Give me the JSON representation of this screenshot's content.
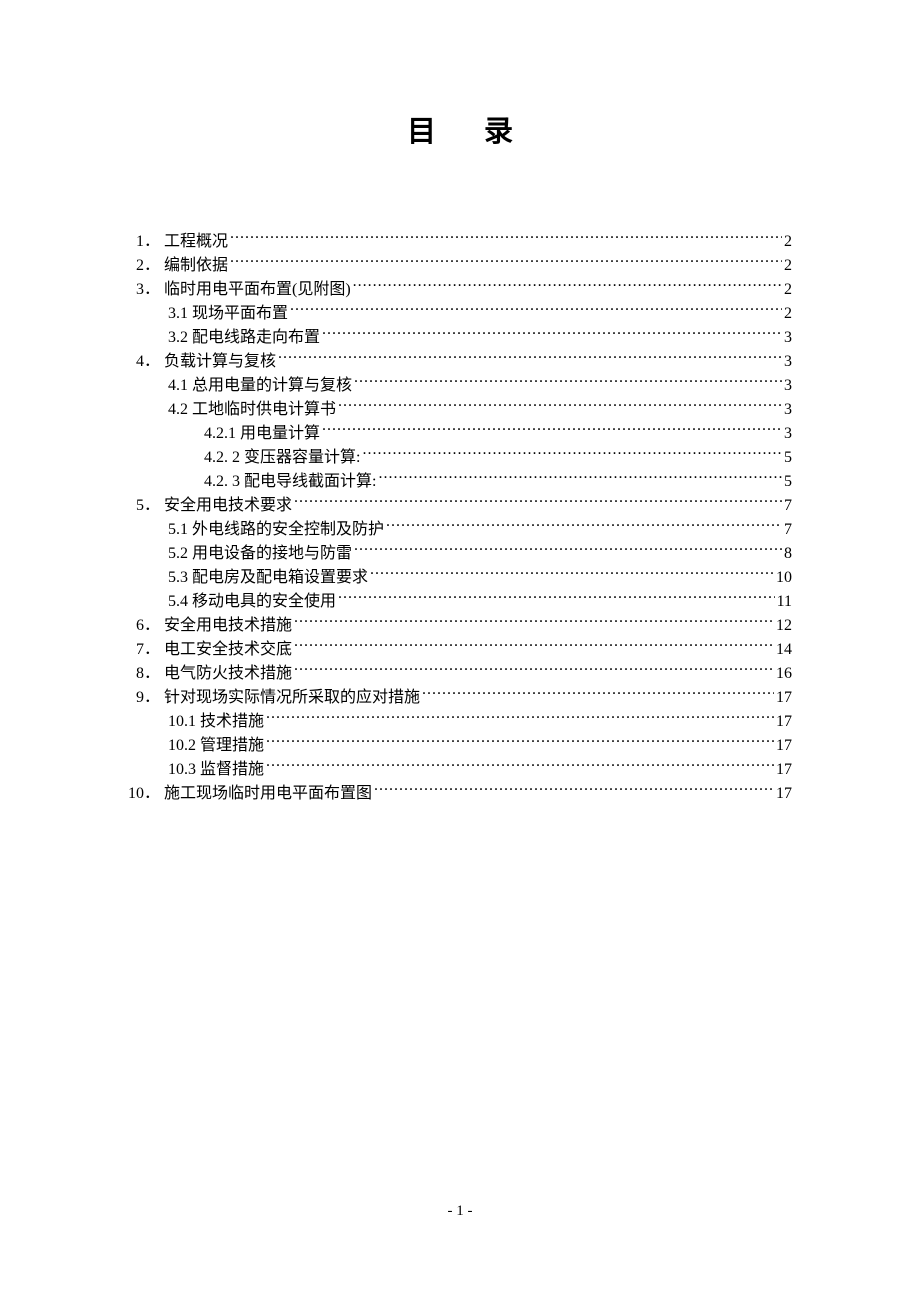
{
  "title": "目录",
  "toc": [
    {
      "level": 0,
      "num": "1．",
      "text": "工程概况",
      "page": "2"
    },
    {
      "level": 0,
      "num": "2．",
      "text": "编制依据",
      "page": "2"
    },
    {
      "level": 0,
      "num": "3．",
      "text": "临时用电平面布置(见附图)",
      "page": "2"
    },
    {
      "level": 1,
      "num": "",
      "text": "3.1  现场平面布置",
      "page": "2"
    },
    {
      "level": 1,
      "num": "",
      "text": "3.2  配电线路走向布置",
      "page": "3"
    },
    {
      "level": 0,
      "num": "4．",
      "text": "负载计算与复核",
      "page": "3"
    },
    {
      "level": 1,
      "num": "",
      "text": "4.1 总用电量的计算与复核",
      "page": "3"
    },
    {
      "level": 1,
      "num": "",
      "text": "4.2 工地临时供电计算书",
      "page": "3"
    },
    {
      "level": 2,
      "num": "",
      "text": "4.2.1 用电量计算",
      "page": "3"
    },
    {
      "level": 2,
      "num": "",
      "text": "4.2. 2 变压器容量计算:",
      "page": "5"
    },
    {
      "level": 2,
      "num": "",
      "text": "4.2. 3 配电导线截面计算:",
      "page": "5"
    },
    {
      "level": 0,
      "num": "5．",
      "text": "安全用电技术要求",
      "page": "7"
    },
    {
      "level": 1,
      "num": "",
      "text": "5.1 外电线路的安全控制及防护",
      "page": "7"
    },
    {
      "level": 1,
      "num": "",
      "text": "5.2  用电设备的接地与防雷",
      "page": "8"
    },
    {
      "level": 1,
      "num": "",
      "text": "5.3  配电房及配电箱设置要求",
      "page": "10"
    },
    {
      "level": 1,
      "num": "",
      "text": "5.4 移动电具的安全使用",
      "page": "11"
    },
    {
      "level": 0,
      "num": "6．",
      "text": "安全用电技术措施",
      "page": "12"
    },
    {
      "level": 0,
      "num": "7．",
      "text": "电工安全技术交底",
      "page": "14"
    },
    {
      "level": 0,
      "num": "8．",
      "text": "电气防火技术措施",
      "page": "16"
    },
    {
      "level": 0,
      "num": "9．",
      "text": "针对现场实际情况所采取的应对措施",
      "page": "17"
    },
    {
      "level": 1,
      "num": "",
      "text": "10.1 技术措施",
      "page": "17"
    },
    {
      "level": 1,
      "num": "",
      "text": "10.2 管理措施",
      "page": "17"
    },
    {
      "level": 1,
      "num": "",
      "text": "10.3 监督措施",
      "page": "17"
    },
    {
      "level": 0,
      "num": "10．",
      "text": "施工现场临时用电平面布置图",
      "page": "17"
    }
  ],
  "page_number": "- 1 -"
}
